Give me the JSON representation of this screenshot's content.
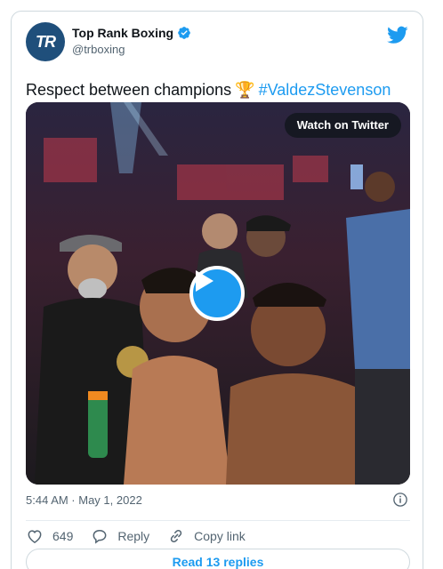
{
  "account": {
    "avatar_text": "TR",
    "name": "Top Rank Boxing",
    "handle": "@trboxing",
    "verified": true
  },
  "tweet": {
    "text": "Respect between champions",
    "emoji_icon": "trophy-icon",
    "hashtag": "#ValdezStevenson"
  },
  "media": {
    "watch_label": "Watch on Twitter",
    "play_icon": "play-icon"
  },
  "timestamp": "5:44 AM · May 1, 2022",
  "actions": {
    "like_count": "649",
    "reply_label": "Reply",
    "copy_link_label": "Copy link"
  },
  "read_replies_label": "Read 13 replies",
  "colors": {
    "accent": "#1d9bf0",
    "text_secondary": "#536471",
    "avatar_bg": "#1f4f7b"
  }
}
